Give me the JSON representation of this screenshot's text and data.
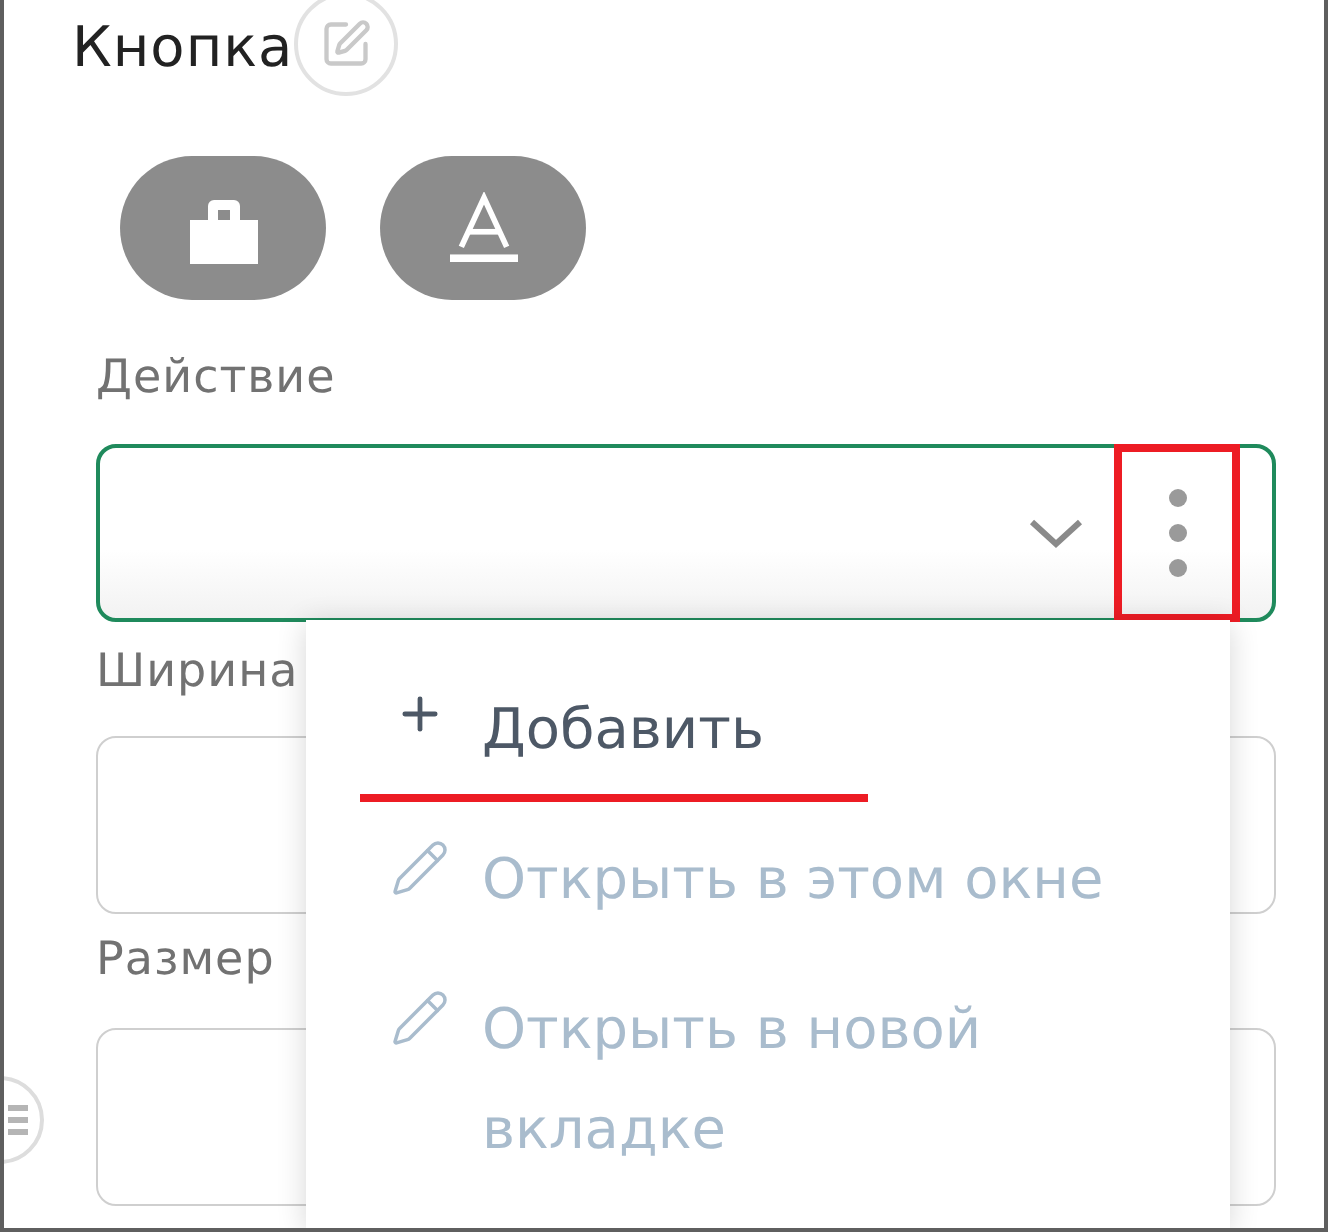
{
  "panel": {
    "title": "Кнопка"
  },
  "style_buttons": [
    {
      "kind": "lock"
    },
    {
      "kind": "text_format"
    }
  ],
  "fields": [
    {
      "label": "Действие",
      "kind": "select",
      "focused": true,
      "more_button": {
        "marked": true
      }
    },
    {
      "label": "Ширина",
      "kind": "text",
      "focused": false
    },
    {
      "label": "Размер",
      "kind": "text",
      "focused": false
    }
  ],
  "menu": {
    "items": [
      {
        "label": "Добавить",
        "kind": "add",
        "disabled": false,
        "marked": true
      },
      {
        "label": "Открыть в этом окне",
        "kind": "edit",
        "disabled": true,
        "marked": false
      },
      {
        "label": "Открыть в новой вкладке",
        "kind": "edit",
        "disabled": true,
        "marked": false
      }
    ]
  }
}
